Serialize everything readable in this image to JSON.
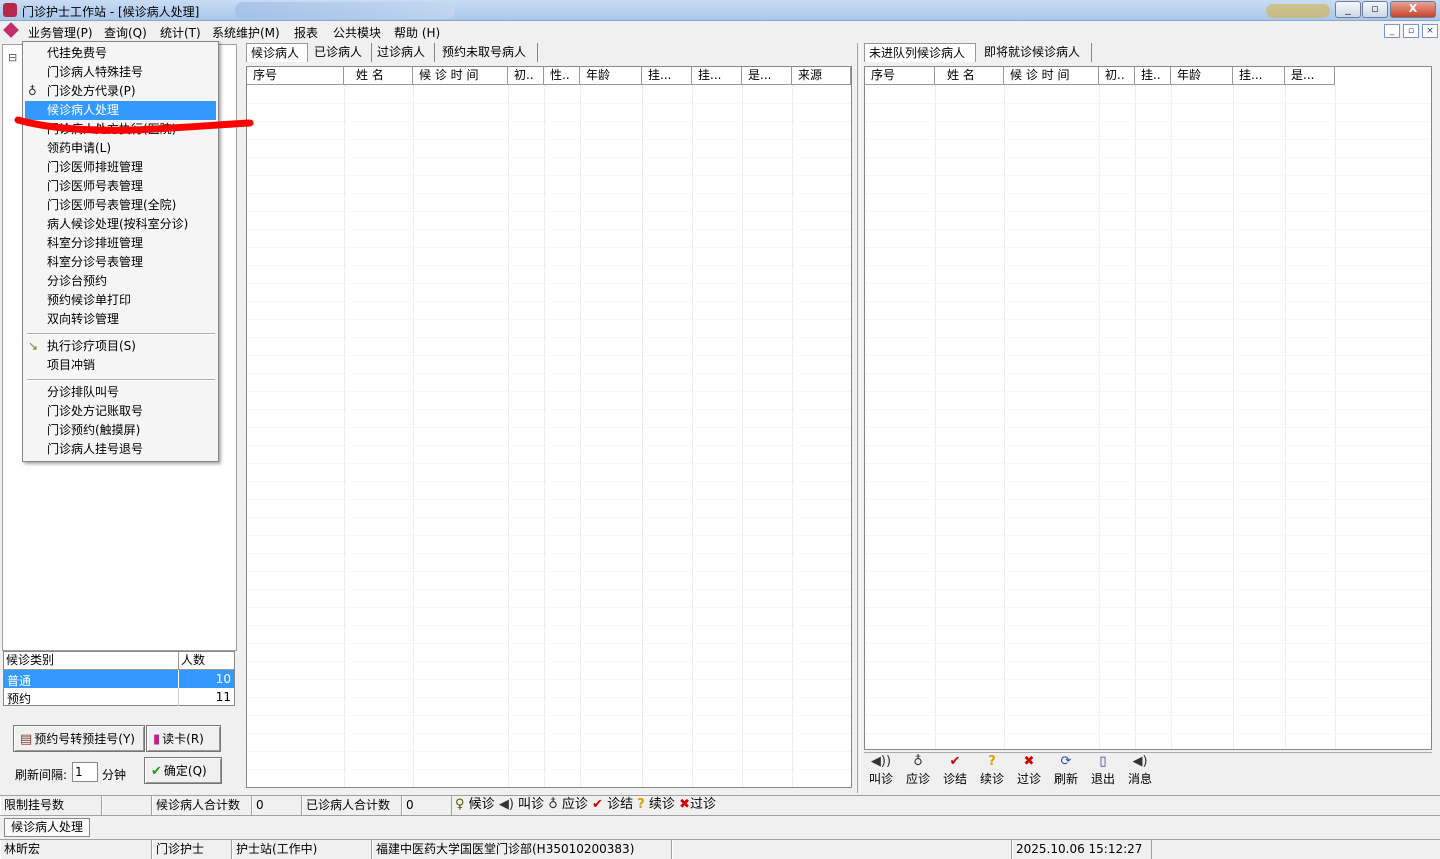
{
  "window": {
    "title": "门诊护士工作站 - [候诊病人处理]",
    "buttons": {
      "minimize": "_",
      "restore": "▫",
      "close": "X"
    }
  },
  "menubar": {
    "items": [
      "业务管理(P)",
      "查询(Q)",
      "统计(T)",
      "系统维护(M)",
      "报表",
      "公共模块",
      "帮助 (H)"
    ],
    "mdi_buttons": [
      "_",
      "▫",
      "×"
    ]
  },
  "dropdown": {
    "group1": [
      {
        "label": "代挂免费号",
        "icon": ""
      },
      {
        "label": "门诊病人特殊挂号",
        "icon": ""
      },
      {
        "label": "门诊处方代录(P)",
        "icon": "stethoscope-icon"
      },
      {
        "label": "候诊病人处理",
        "icon": "",
        "selected": true
      },
      {
        "label": "门诊病人处方执行(医院)",
        "icon": "",
        "obscured": true
      },
      {
        "label": "领药申请(L)",
        "icon": ""
      },
      {
        "label": "门诊医师排班管理",
        "icon": ""
      },
      {
        "label": "门诊医师号表管理",
        "icon": ""
      },
      {
        "label": "门诊医师号表管理(全院)",
        "icon": ""
      },
      {
        "label": "病人候诊处理(按科室分诊)",
        "icon": ""
      },
      {
        "label": "科室分诊排班管理",
        "icon": ""
      },
      {
        "label": "科室分诊号表管理",
        "icon": ""
      },
      {
        "label": "分诊台预约",
        "icon": ""
      },
      {
        "label": "预约候诊单打印",
        "icon": ""
      },
      {
        "label": "双向转诊管理",
        "icon": ""
      }
    ],
    "group2": [
      {
        "label": "执行诊疗项目(S)",
        "icon": "execute-icon"
      },
      {
        "label": "项目冲销",
        "icon": ""
      }
    ],
    "group3": [
      {
        "label": "分诊排队叫号",
        "icon": ""
      },
      {
        "label": "门诊处方记账取号",
        "icon": ""
      },
      {
        "label": "门诊预约(触摸屏)",
        "icon": ""
      },
      {
        "label": "门诊病人挂号退号",
        "icon": ""
      }
    ]
  },
  "left_panel": {
    "tree_toggle": "⊟",
    "category_table": {
      "headers": [
        "候诊类别",
        "人数"
      ],
      "rows": [
        {
          "category": "普通",
          "count": "10",
          "selected": true
        },
        {
          "category": "预约",
          "count": "11",
          "selected": false
        }
      ]
    },
    "convert_button": "预约号转预挂号(Y)",
    "read_card_button": "读卡(R)",
    "refresh_label": "刷新间隔:",
    "refresh_value": "1",
    "refresh_unit": "分钟",
    "confirm_button": "确定(Q)"
  },
  "middle_panel": {
    "tabs": [
      "候诊病人",
      "已诊病人",
      "过诊病人",
      "预约未取号病人"
    ],
    "columns": [
      "序号",
      "姓  名",
      "候 诊 时 间",
      "初..",
      "性..",
      "年龄",
      "挂...",
      "挂...",
      "是...",
      "来源"
    ]
  },
  "right_panel": {
    "tabs": [
      "未进队列候诊病人",
      "即将就诊候诊病人"
    ],
    "columns": [
      "序号",
      "姓  名",
      "候 诊 时 间",
      "初..",
      "挂..",
      "年龄",
      "挂...",
      "是..."
    ],
    "toolbar": [
      {
        "label": "叫诊",
        "icon": "speaker-icon"
      },
      {
        "label": "应诊",
        "icon": "stethoscope-icon"
      },
      {
        "label": "诊结",
        "icon": "check-icon"
      },
      {
        "label": "续诊",
        "icon": "question-icon"
      },
      {
        "label": "过诊",
        "icon": "x-icon"
      },
      {
        "label": "刷新",
        "icon": "refresh-icon"
      },
      {
        "label": "退出",
        "icon": "exit-door-icon"
      },
      {
        "label": "消息",
        "icon": "message-icon"
      }
    ]
  },
  "status1": {
    "limit_label": "限制挂号数",
    "limit_value": "",
    "waiting_label": "候诊病人合计数",
    "waiting_value": "0",
    "done_label": "已诊病人合计数",
    "done_value": "0",
    "legend": [
      "候诊",
      "叫诊",
      "应诊",
      "诊结",
      "续诊",
      "过诊"
    ]
  },
  "status2": {
    "active_window": "候诊病人处理"
  },
  "status3": {
    "user": "林昕宏",
    "role": "门诊护士",
    "station": "护士站(工作中)",
    "hospital": "福建中医药大学国医堂门诊部(H35010200383)",
    "datetime": "2025.10.06 15:12:27"
  },
  "colors": {
    "selection": "#3399ff",
    "annotation": "#ff0000",
    "check": "#d00000"
  }
}
